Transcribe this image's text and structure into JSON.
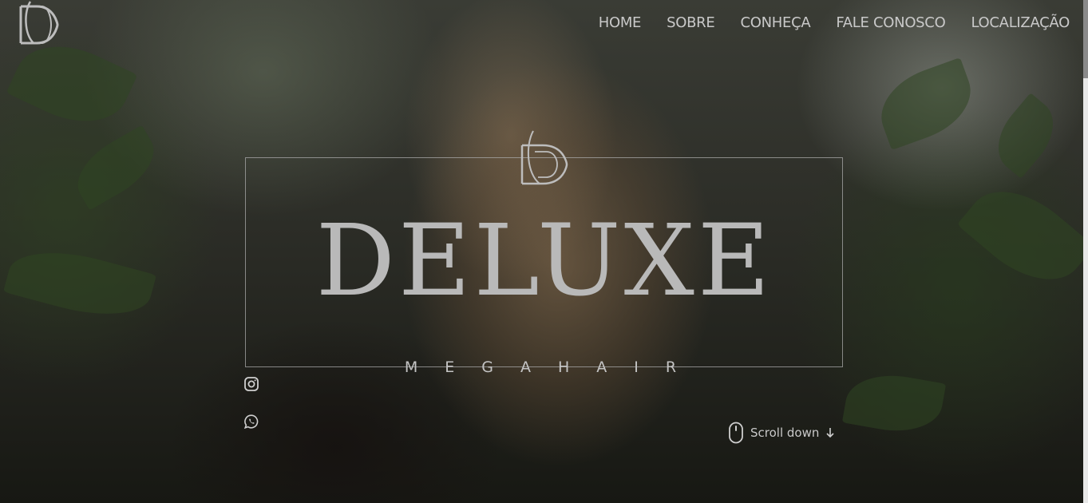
{
  "header": {
    "logo_icon": "deluxe-monogram-icon",
    "nav": [
      {
        "label": "HOME"
      },
      {
        "label": "SOBRE"
      },
      {
        "label": "CONHEÇA"
      },
      {
        "label": "FALE CONOSCO"
      },
      {
        "label": "LOCALIZAÇÃO"
      }
    ]
  },
  "hero": {
    "brand_name": "DELUXE",
    "brand_tagline": "MEGAHAIR",
    "social": [
      {
        "icon": "instagram-icon"
      },
      {
        "icon": "whatsapp-icon"
      }
    ],
    "scroll_label": "Scroll down",
    "scroll_icon": "mouse-icon"
  },
  "colors": {
    "text": "#c9c9c9",
    "frame": "#aaaaaa",
    "overlay": "#1a1b16"
  }
}
